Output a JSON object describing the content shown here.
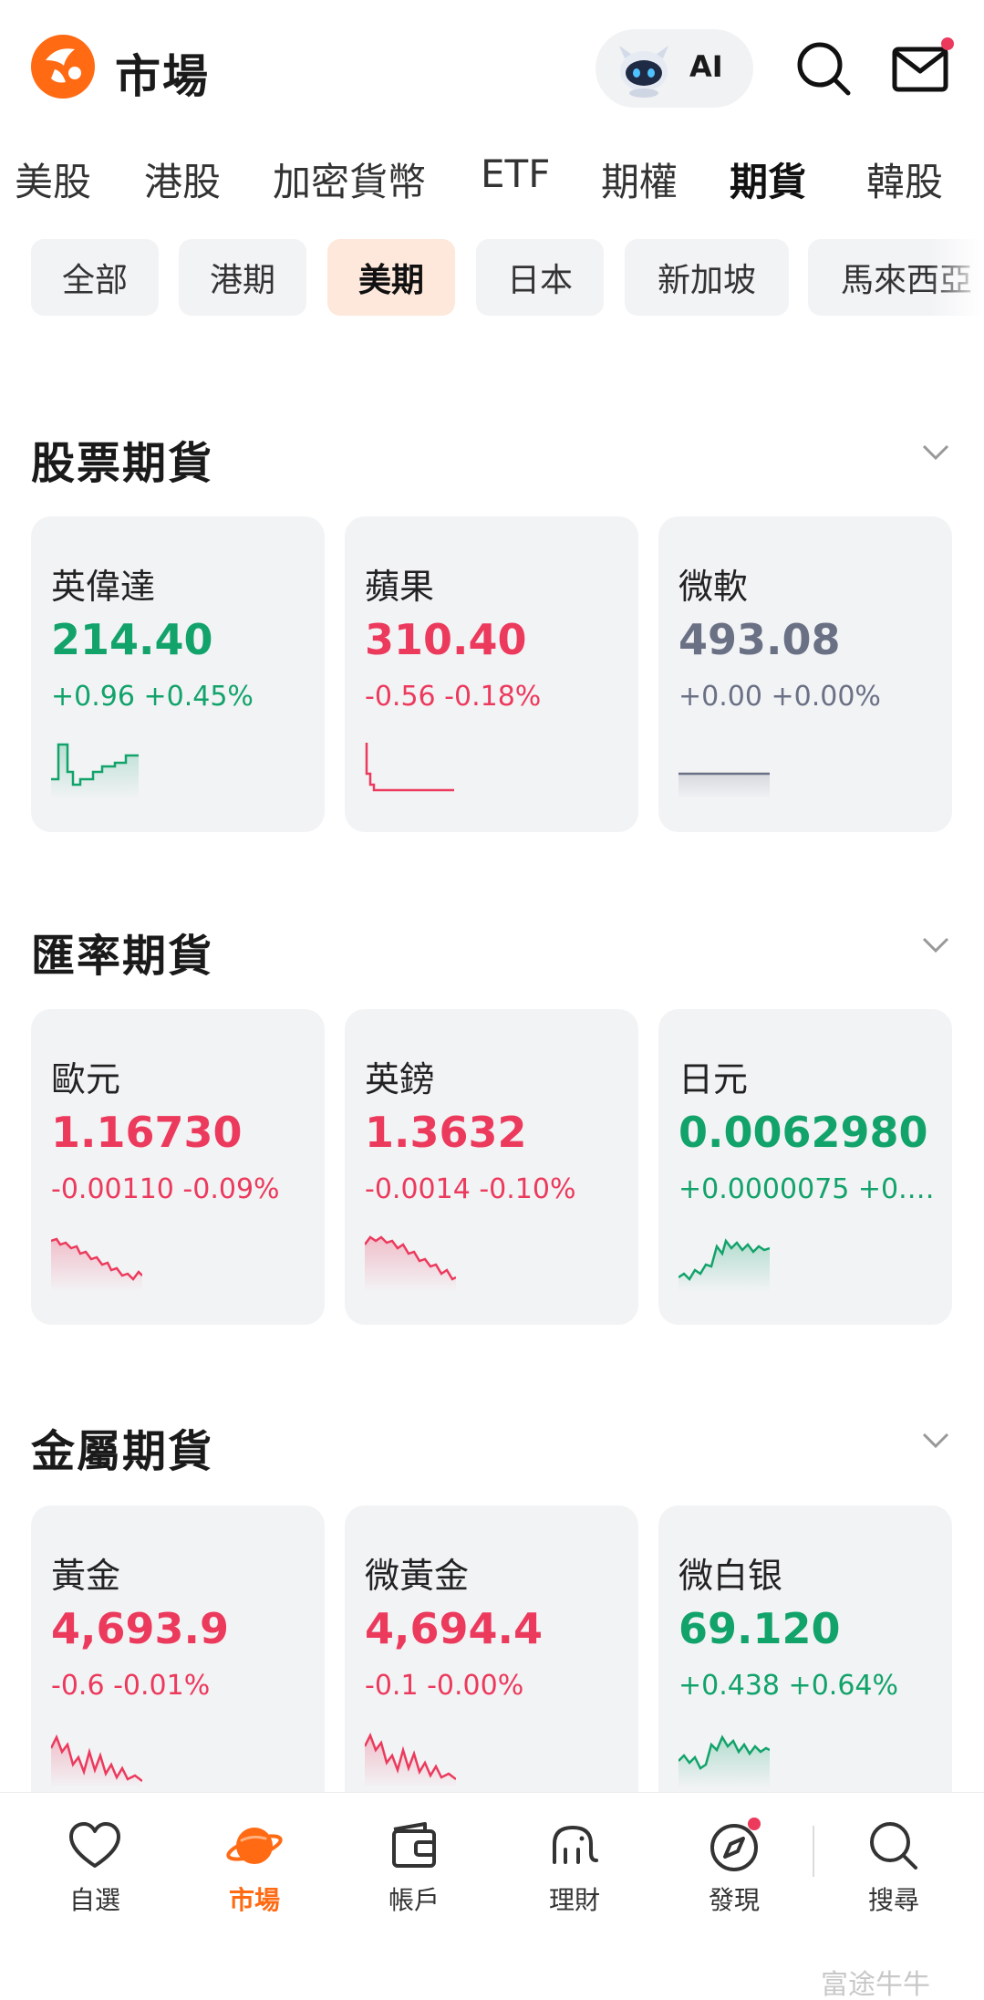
{
  "header": {
    "title": "市場",
    "ai_label": "AI"
  },
  "tabs": [
    {
      "label": "美股",
      "active": false
    },
    {
      "label": "港股",
      "active": false
    },
    {
      "label": "加密貨幣",
      "active": false
    },
    {
      "label": "ETF",
      "active": false
    },
    {
      "label": "期權",
      "active": false
    },
    {
      "label": "期貨",
      "active": true
    },
    {
      "label": "韓股",
      "active": false
    }
  ],
  "chips": [
    {
      "label": "全部",
      "active": false
    },
    {
      "label": "港期",
      "active": false
    },
    {
      "label": "美期",
      "active": true
    },
    {
      "label": "日本",
      "active": false
    },
    {
      "label": "新加坡",
      "active": false
    },
    {
      "label": "馬來西亞",
      "active": false
    }
  ],
  "sections": [
    {
      "title": "股票期貨",
      "cards": [
        {
          "name": "英偉達",
          "price": "214.40",
          "change": "+0.96 +0.45%",
          "trend": "up"
        },
        {
          "name": "蘋果",
          "price": "310.40",
          "change": "-0.56 -0.18%",
          "trend": "down"
        },
        {
          "name": "微軟",
          "price": "493.08",
          "change": "+0.00 +0.00%",
          "trend": "flat"
        }
      ]
    },
    {
      "title": "匯率期貨",
      "cards": [
        {
          "name": "歐元",
          "price": "1.16730",
          "change": "-0.00110 -0.09%",
          "trend": "down"
        },
        {
          "name": "英鎊",
          "price": "1.3632",
          "change": "-0.0014 -0.10%",
          "trend": "down"
        },
        {
          "name": "日元",
          "price": "0.0062980",
          "change": "+0.0000075 +0.1…",
          "trend": "up"
        }
      ]
    },
    {
      "title": "金屬期貨",
      "cards": [
        {
          "name": "黃金",
          "price": "4,693.9",
          "change": "-0.6 -0.01%",
          "trend": "down"
        },
        {
          "name": "微黃金",
          "price": "4,694.4",
          "change": "-0.1 -0.00%",
          "trend": "down"
        },
        {
          "name": "微白银",
          "price": "69.120",
          "change": "+0.438 +0.64%",
          "trend": "up"
        }
      ]
    }
  ],
  "bottom_nav": [
    {
      "label": "自選",
      "icon": "heart-icon",
      "active": false
    },
    {
      "label": "市場",
      "icon": "planet-icon",
      "active": true
    },
    {
      "label": "帳戶",
      "icon": "wallet-icon",
      "active": false
    },
    {
      "label": "理財",
      "icon": "elephant-icon",
      "active": false
    },
    {
      "label": "發現",
      "icon": "compass-icon",
      "active": false
    },
    {
      "label": "搜尋",
      "icon": "search-icon",
      "active": false
    }
  ],
  "watermark": "富途牛牛",
  "colors": {
    "up": "#12a36b",
    "down": "#ec3a5d",
    "flat": "#6b7185",
    "accent": "#ff6a13"
  }
}
